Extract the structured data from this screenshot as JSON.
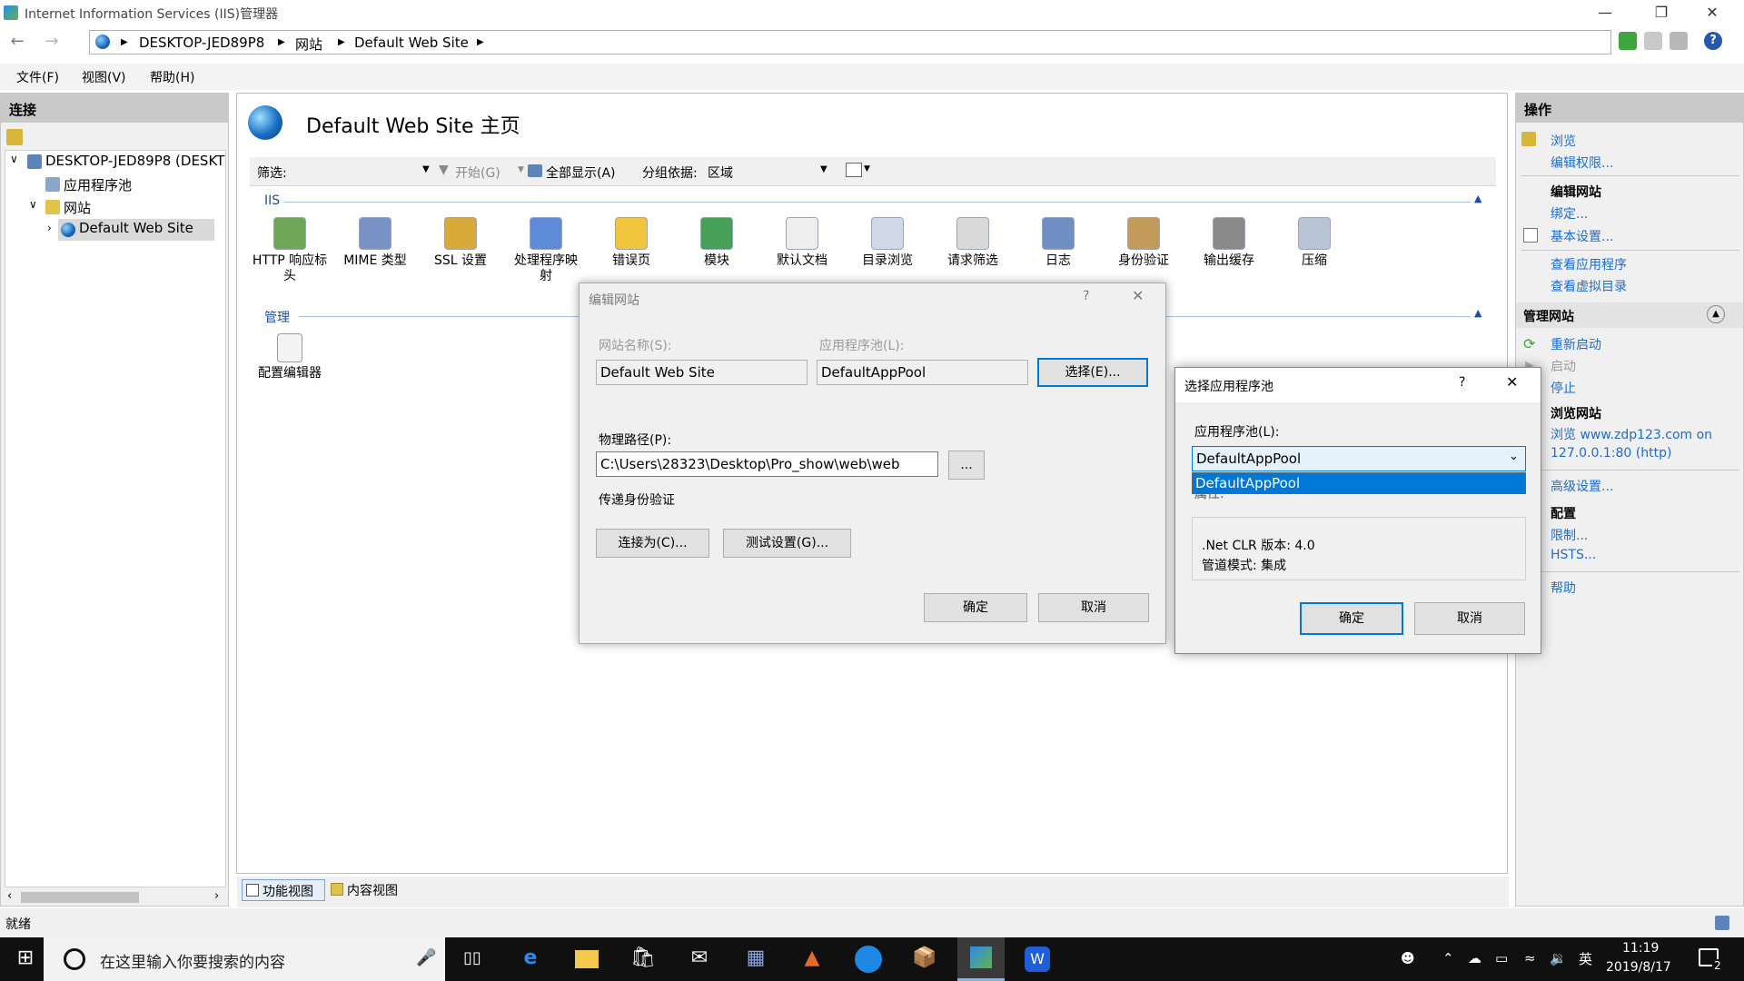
{
  "window": {
    "title": "Internet Information Services (IIS)管理器"
  },
  "breadcrumb": [
    "DESKTOP-JED89P8",
    "网站",
    "Default Web Site"
  ],
  "menu": [
    "文件(F)",
    "视图(V)",
    "帮助(H)"
  ],
  "left_panel": {
    "title": "连接",
    "tree": [
      "DESKTOP-JED89P8 (DESKT",
      "应用程序池",
      "网站",
      "Default Web Site"
    ]
  },
  "center": {
    "title": "Default Web Site 主页",
    "filter_label": "筛选:",
    "start_label": "开始(G)",
    "showall_label": "全部显示(A)",
    "groupby_label": "分组依据:",
    "groupby_value": "区域",
    "section_iis": "IIS",
    "iis_features": [
      {
        "label": "HTTP 响应标\n头",
        "icon": "http-response-headers-icon"
      },
      {
        "label": "MIME 类型",
        "icon": "mime-types-icon"
      },
      {
        "label": "SSL 设置",
        "icon": "ssl-lock-icon"
      },
      {
        "label": "处理程序映\n射",
        "icon": "handler-mappings-icon"
      },
      {
        "label": "错误页",
        "icon": "error-pages-icon"
      },
      {
        "label": "模块",
        "icon": "modules-icon"
      },
      {
        "label": "默认文档",
        "icon": "default-document-icon"
      },
      {
        "label": "目录浏览",
        "icon": "directory-browsing-icon"
      },
      {
        "label": "请求筛选",
        "icon": "request-filtering-icon"
      },
      {
        "label": "日志",
        "icon": "logging-icon"
      },
      {
        "label": "身份验证",
        "icon": "authentication-icon"
      },
      {
        "label": "输出缓存",
        "icon": "output-caching-icon"
      },
      {
        "label": "压缩",
        "icon": "compression-icon"
      }
    ],
    "section_manage": "管理",
    "manage_features": [
      {
        "label": "配置编辑器",
        "icon": "configuration-editor-icon"
      }
    ],
    "view_tabs": [
      "功能视图",
      "内容视图"
    ]
  },
  "right_panel": {
    "title": "操作",
    "browse": "浏览",
    "edit_permissions": "编辑权限...",
    "edit_site": "编辑网站",
    "bindings": "绑定...",
    "basic_settings": "基本设置...",
    "view_apps": "查看应用程序",
    "view_vdirs": "查看虚拟目录",
    "manage_site": "管理网站",
    "restart": "重新启动",
    "start": "启动",
    "stop": "停止",
    "browse_site": "浏览网站",
    "browse_link": "浏览 www.zdp123.com on\n127.0.0.1:80 (http)",
    "advanced": "高级设置...",
    "config": "配置",
    "limits": "限制...",
    "hsts": "HSTS...",
    "help": "帮助"
  },
  "edit_site_dialog": {
    "title": "编辑网站",
    "site_name_label": "网站名称(S):",
    "site_name_value": "Default Web Site",
    "app_pool_label": "应用程序池(L):",
    "app_pool_value": "DefaultAppPool",
    "select_button": "选择(E)...",
    "physical_path_label": "物理路径(P):",
    "physical_path_value": "C:\\Users\\28323\\Desktop\\Pro_show\\web\\web",
    "browse_button": "...",
    "passthrough_label": "传递身份验证",
    "connect_as_button": "连接为(C)...",
    "test_settings_button": "测试设置(G)...",
    "ok_button": "确定",
    "cancel_button": "取消"
  },
  "select_pool_dialog": {
    "title": "选择应用程序池",
    "pool_label": "应用程序池(L):",
    "selected_value": "DefaultAppPool",
    "dropdown_option": "DefaultAppPool",
    "hidden_label_fragment": "属性:",
    "clr_version": ".Net CLR 版本: 4.0",
    "pipeline_mode": "管道模式: 集成",
    "ok_button": "确定",
    "cancel_button": "取消"
  },
  "status_bar": {
    "text": "就绪"
  },
  "taskbar": {
    "search_placeholder": "在这里输入你要搜索的内容",
    "ime": "英",
    "time": "11:19",
    "date": "2019/8/17",
    "notification_count": "2"
  },
  "colors": {
    "link": "#1c6dd0",
    "selection": "#0078d7",
    "taskbar": "#101010"
  }
}
